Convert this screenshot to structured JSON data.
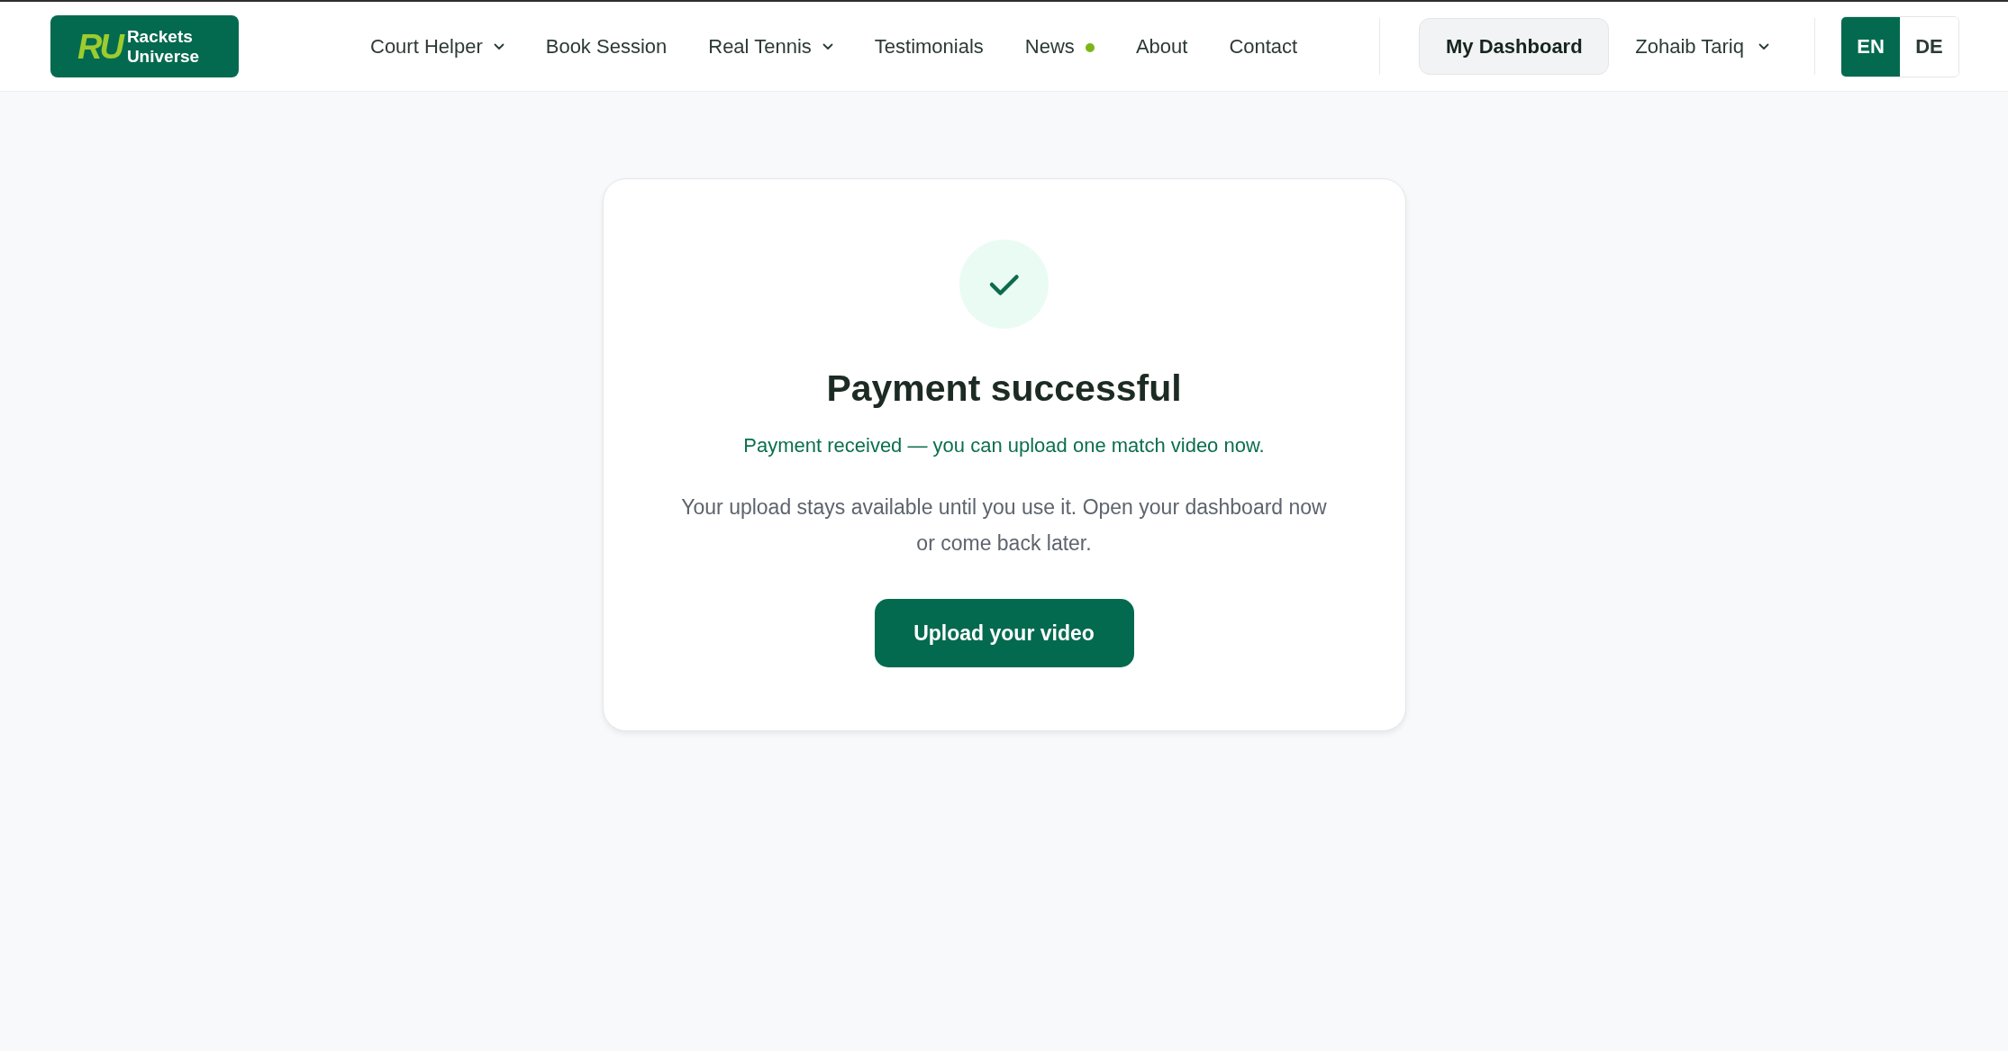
{
  "header": {
    "logo": {
      "mark": "RU",
      "wordmark": [
        "Rackets",
        "Universe"
      ]
    },
    "nav": [
      {
        "label": "Court Helper",
        "kind": "menu",
        "new": false
      },
      {
        "label": "Book Session",
        "kind": "link",
        "new": false
      },
      {
        "label": "Real Tennis",
        "kind": "menu",
        "new": false
      },
      {
        "label": "Testimonials",
        "kind": "link",
        "new": false
      },
      {
        "label": "News",
        "kind": "link",
        "new": true
      },
      {
        "label": "About",
        "kind": "link",
        "new": false
      },
      {
        "label": "Contact",
        "kind": "link",
        "new": false
      }
    ],
    "dashboard_button": "My Dashboard",
    "user_menu": "Zohaib Tariq",
    "languages": [
      {
        "label": "EN",
        "selected": true
      },
      {
        "label": "DE",
        "selected": false
      }
    ]
  },
  "card": {
    "title": "Payment successful",
    "message": "Payment received — you can upload one match video now.",
    "body": "Your upload stays available until you use it. Open your dashboard now or come back later.",
    "button": "Upload your video"
  }
}
